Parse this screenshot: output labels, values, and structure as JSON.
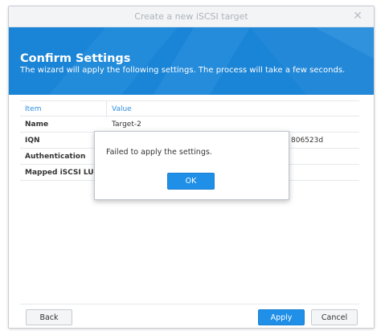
{
  "window": {
    "title": "Create a new iSCSI target",
    "close_glyph": "✕"
  },
  "banner": {
    "title": "Confirm Settings",
    "subtitle": "The wizard will apply the following settings. The process will take a few seconds."
  },
  "table": {
    "headers": [
      "Item",
      "Value"
    ],
    "rows": [
      {
        "item": "Name",
        "value": "Target-2"
      },
      {
        "item": "IQN",
        "value": "",
        "value_tail": "806523d"
      },
      {
        "item": "Authentication",
        "value": ""
      },
      {
        "item": "Mapped iSCSI LUN",
        "value": ""
      }
    ]
  },
  "buttons": {
    "back": "Back",
    "apply": "Apply",
    "cancel": "Cancel"
  },
  "dialog": {
    "message": "Failed to apply the settings.",
    "ok": "OK"
  },
  "colors": {
    "banner": "#1a84d6",
    "accent": "#1f8fe8",
    "header_text": "#2d8fde"
  }
}
